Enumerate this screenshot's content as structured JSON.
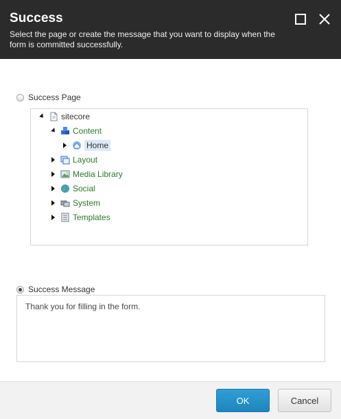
{
  "dialog": {
    "title": "Success",
    "subtitle": "Select the page or create the message that you want to display when the form is committed successfully."
  },
  "options": {
    "success_page_label": "Success Page",
    "success_message_label": "Success Message",
    "selected": "success_message"
  },
  "tree": {
    "root": "sitecore",
    "content": "Content",
    "home": "Home",
    "layout": "Layout",
    "media_library": "Media Library",
    "social": "Social",
    "system": "System",
    "templates": "Templates"
  },
  "message": {
    "value": "Thank you for filling in the form."
  },
  "footer": {
    "ok_label": "OK",
    "cancel_label": "Cancel"
  },
  "colors": {
    "header_bg": "#2b2b2b",
    "tree_label": "#2a7a2a",
    "ok_bg": "#2592c9"
  }
}
